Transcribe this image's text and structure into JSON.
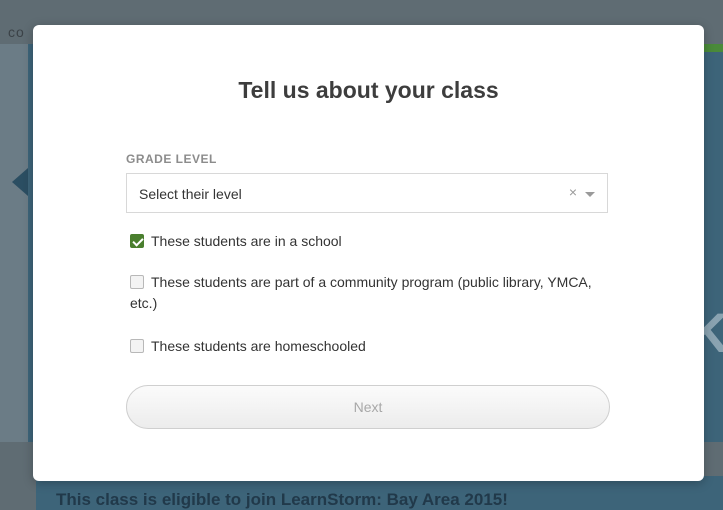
{
  "background": {
    "topbar_text": "co",
    "footer_text": "This class is eligible to join LearnStorm: Bay Area 2015!",
    "side_letter": "K"
  },
  "modal": {
    "title": "Tell us about your class",
    "grade_label": "GRADE LEVEL",
    "grade_select": {
      "value": "Select their level",
      "clear_glyph": "×"
    },
    "options": [
      {
        "label": "These students are in a school",
        "checked": true
      },
      {
        "label": "These students are part of a community program (public library, YMCA, etc.)",
        "checked": false
      },
      {
        "label": "These students are homeschooled",
        "checked": false
      }
    ],
    "next_label": "Next"
  },
  "colors": {
    "accent_check": "#4a7f2e",
    "overlay": "#6b7c86",
    "bg_panel": "#3d6479"
  },
  "icons": [
    "clear-icon",
    "chevron-down-icon",
    "checkmark-icon"
  ]
}
